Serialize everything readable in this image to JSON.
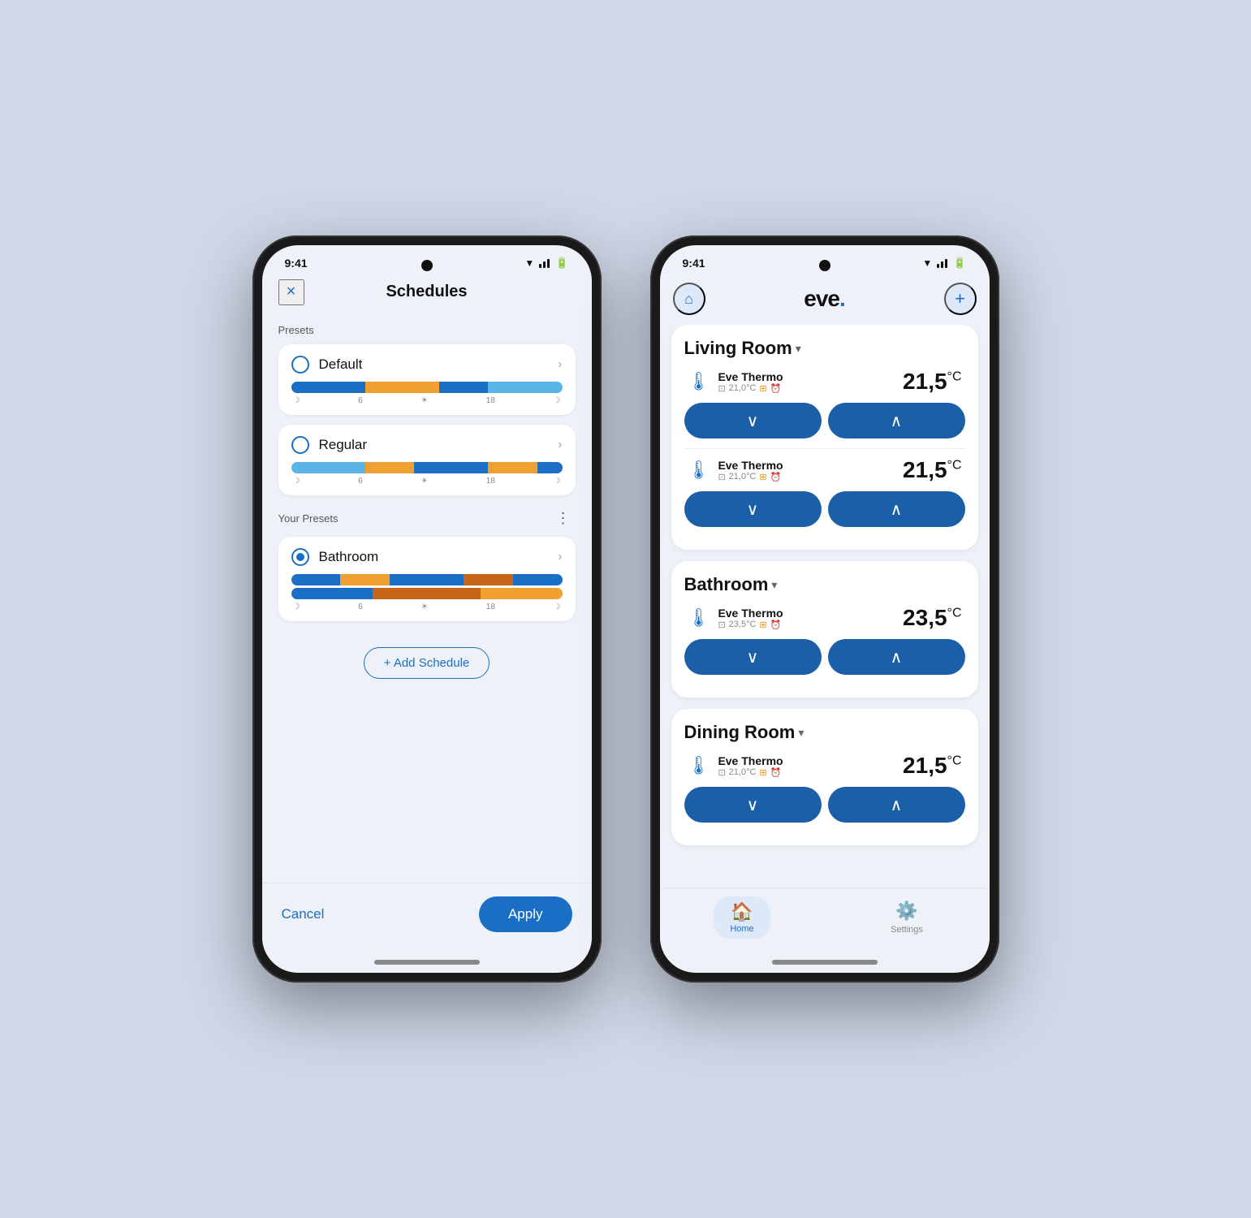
{
  "phone1": {
    "time": "9:41",
    "title": "Schedules",
    "close_label": "×",
    "presets_label": "Presets",
    "your_presets_label": "Your Presets",
    "presets": [
      {
        "name": "Default",
        "selected": false,
        "bar": [
          {
            "type": "blue-dark",
            "flex": 3
          },
          {
            "type": "orange",
            "flex": 3
          },
          {
            "type": "blue-dark",
            "flex": 2
          },
          {
            "type": "blue-light",
            "flex": 3
          }
        ]
      },
      {
        "name": "Regular",
        "selected": false,
        "bar": [
          {
            "type": "blue-light",
            "flex": 3
          },
          {
            "type": "orange",
            "flex": 2
          },
          {
            "type": "blue-dark",
            "flex": 3
          },
          {
            "type": "orange",
            "flex": 2
          },
          {
            "type": "blue-dark",
            "flex": 1
          }
        ]
      }
    ],
    "your_presets": [
      {
        "name": "Bathroom",
        "selected": true,
        "bar_top": [
          {
            "type": "blue-dark",
            "flex": 2
          },
          {
            "type": "orange",
            "flex": 2
          },
          {
            "type": "blue-dark",
            "flex": 3
          },
          {
            "type": "orange-dark",
            "flex": 2
          },
          {
            "type": "blue-dark",
            "flex": 2
          }
        ],
        "bar_bottom": [
          {
            "type": "blue-dark",
            "flex": 3
          },
          {
            "type": "orange-dark",
            "flex": 4
          },
          {
            "type": "orange",
            "flex": 3
          }
        ]
      }
    ],
    "ticks": [
      "☽",
      "6",
      "☀",
      "18",
      "☽"
    ],
    "add_schedule": "+ Add Schedule",
    "cancel": "Cancel",
    "apply": "Apply"
  },
  "phone2": {
    "time": "9:41",
    "app_name": "eve",
    "rooms": [
      {
        "name": "Living Room",
        "devices": [
          {
            "name": "Eve Thermo",
            "sub_temp": "21,0°C",
            "temp": "21,5",
            "unit": "°C"
          },
          {
            "name": "Eve Thermo",
            "sub_temp": "21,0°C",
            "temp": "21,5",
            "unit": "°C"
          }
        ]
      },
      {
        "name": "Bathroom",
        "devices": [
          {
            "name": "Eve Thermo",
            "sub_temp": "23,5°C",
            "temp": "23,5",
            "unit": "°C"
          }
        ]
      },
      {
        "name": "Dining Room",
        "devices": [
          {
            "name": "Eve Thermo",
            "sub_temp": "21,0°C",
            "temp": "21,5",
            "unit": "°C"
          }
        ]
      }
    ],
    "nav": [
      {
        "label": "Home",
        "icon": "🏠",
        "active": true
      },
      {
        "label": "Settings",
        "icon": "⚙️",
        "active": false
      }
    ]
  }
}
